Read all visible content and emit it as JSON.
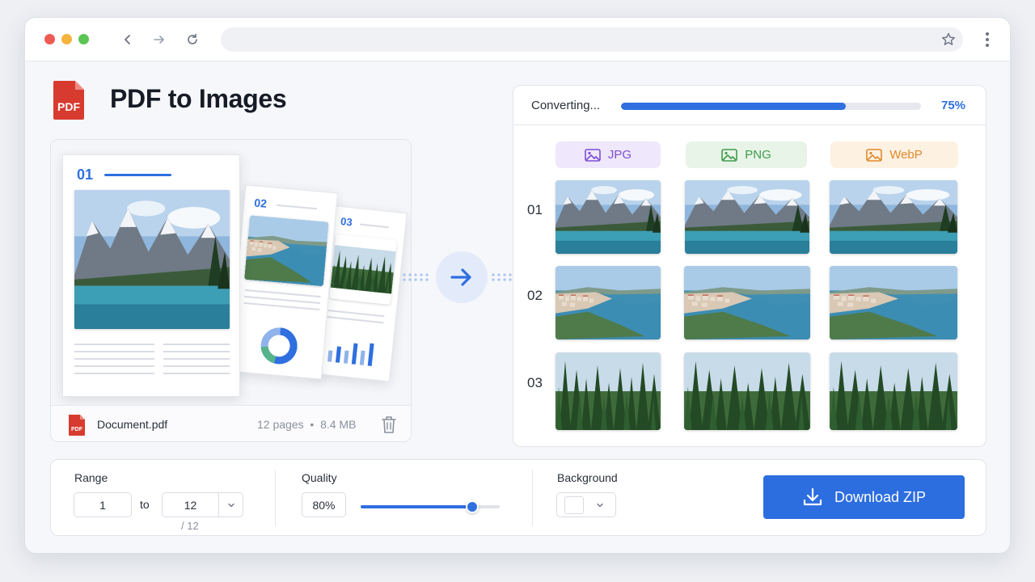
{
  "app": {
    "title": "PDF to Images",
    "logo_text": "PDF"
  },
  "preview": {
    "page_numbers": [
      "01",
      "02",
      "03"
    ]
  },
  "file": {
    "icon_text": "PDF",
    "name": "Document.pdf",
    "meta": "12 pages  •  8.4 MB"
  },
  "progress": {
    "label": "Converting...",
    "percent_text": "75%",
    "fraction": 0.75
  },
  "formats": [
    {
      "label": "JPG",
      "color": "#7b4fd6",
      "bg": "#efe7fb"
    },
    {
      "label": "PNG",
      "color": "#3f9b4b",
      "bg": "#e8f4e8"
    },
    {
      "label": "WebP",
      "color": "#e08a2a",
      "bg": "#fdf1e2"
    }
  ],
  "rows": [
    "01",
    "02",
    "03"
  ],
  "controls": {
    "range": {
      "label": "Range",
      "from": "1",
      "to_word": "to",
      "to": "12",
      "total": "/ 12"
    },
    "quality": {
      "label": "Quality",
      "value": "80%",
      "fraction": 0.8
    },
    "background": {
      "label": "Background",
      "swatch_color": "#ffffff"
    },
    "download_label": "Download ZIP"
  },
  "colors": {
    "accent": "#2f6fe0"
  },
  "icons": [
    "back-icon",
    "forward-icon",
    "reload-icon",
    "star-icon",
    "kebab-icon",
    "pdf-file-icon",
    "trash-icon",
    "arrow-right-icon",
    "image-icon",
    "chevron-down-icon",
    "download-icon"
  ]
}
